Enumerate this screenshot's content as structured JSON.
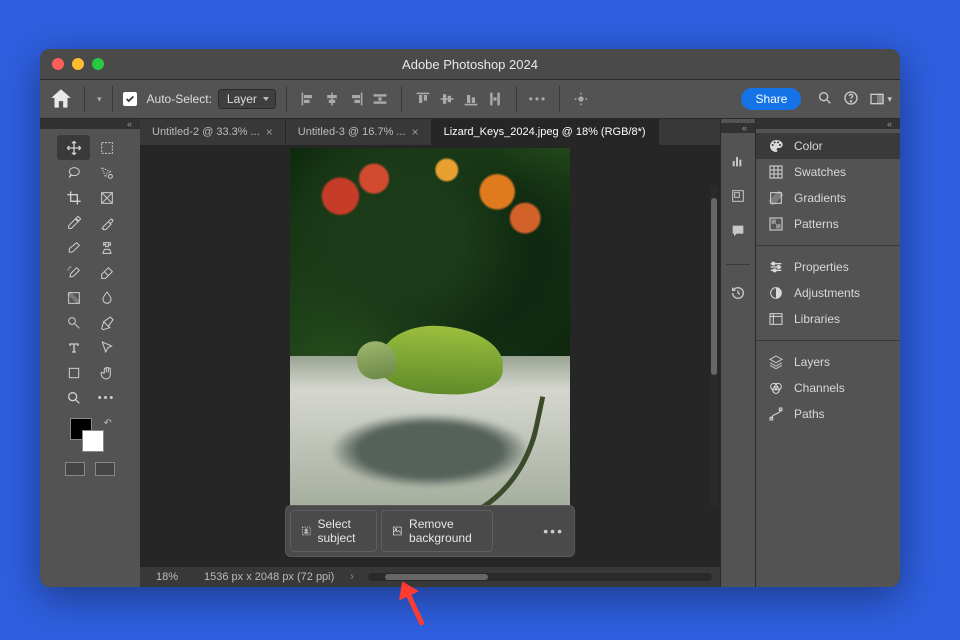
{
  "window": {
    "title": "Adobe Photoshop 2024"
  },
  "options_bar": {
    "auto_select_label": "Auto-Select:",
    "auto_select_checked": true,
    "layer_dropdown": "Layer",
    "share_label": "Share"
  },
  "tabs": [
    {
      "label": "Untitled-2 @ 33.3% ...",
      "active": false,
      "closeable": true
    },
    {
      "label": "Untitled-3 @ 16.7% ...",
      "active": false,
      "closeable": true
    },
    {
      "label": "Lizard_Keys_2024.jpeg @ 18% (RGB/8*)",
      "active": true,
      "closeable": false
    }
  ],
  "context_bar": {
    "select_subject": "Select subject",
    "remove_background": "Remove background"
  },
  "status": {
    "zoom": "18%",
    "dimensions": "1536 px x 2048 px (72 ppi)"
  },
  "panels": {
    "group1": [
      "Color",
      "Swatches",
      "Gradients",
      "Patterns"
    ],
    "group2": [
      "Properties",
      "Adjustments",
      "Libraries"
    ],
    "group3": [
      "Layers",
      "Channels",
      "Paths"
    ]
  },
  "panel_icons": {
    "Color": "palette",
    "Swatches": "grid",
    "Gradients": "gradient",
    "Patterns": "pattern",
    "Properties": "sliders",
    "Adjustments": "circle-half",
    "Libraries": "libraries",
    "Layers": "layers",
    "Channels": "channels",
    "Paths": "paths"
  }
}
